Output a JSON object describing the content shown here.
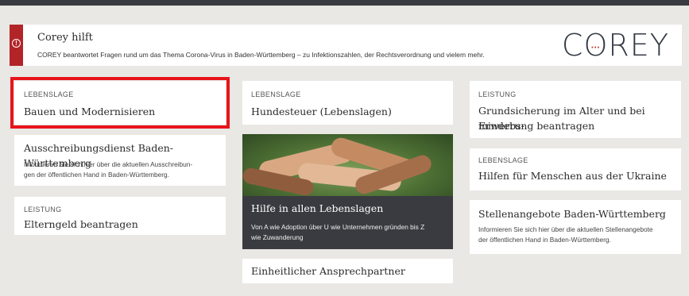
{
  "corey": {
    "icon": "info-icon",
    "title": "Corey hilft",
    "description": "COREY beantwortet Fragen rund um das Thema Corona-Virus in Baden-Württemberg – zu Infektionszahlen, der Rechtsverordnung und vielem mehr.",
    "logo_c": "C",
    "logo_o": "O",
    "logo_rest": "REY",
    "logo_dots": "···",
    "accent": "#b32428"
  },
  "cards": {
    "bauen": {
      "kicker": "LEBENSLAGE",
      "title": "Bauen und Modernisieren"
    },
    "hundesteuer": {
      "kicker": "LEBENSLAGE",
      "title": "Hundesteuer (Lebenslagen)"
    },
    "grundsicherung": {
      "kicker": "LEISTUNG",
      "title_1": "Grundsicherung im Alter und bei Erwerbs-",
      "title_2": "minderung beantragen"
    },
    "ausschreibung": {
      "title": "Ausschreibungsdienst Baden-Württemberg",
      "desc_1": "Informieren Sie sich hier über die aktuellen Ausschreibun-",
      "desc_2": "gen der öffentlichen Hand in Baden-Württemberg."
    },
    "ukraine": {
      "kicker": "LEBENSLAGE",
      "title": "Hilfen für Menschen aus der Ukraine"
    },
    "elterngeld": {
      "kicker": "LEISTUNG",
      "title": "Elterngeld beantragen"
    },
    "hilfe": {
      "title": "Hilfe in allen Lebenslagen",
      "desc_1": "Von A wie Adoption über U wie Unternehmen gründen bis Z",
      "desc_2": "wie Zuwanderung"
    },
    "stellen": {
      "title": "Stellenangebote Baden-Württemberg",
      "desc_1": "Informieren Sie sich hier über die aktuellen Stellenangebote",
      "desc_2": "der öffentlichen Hand in Baden-Württemberg."
    },
    "ansprech": {
      "title": "Einheitlicher Ansprechpartner"
    }
  },
  "highlight_color": "#e8141b"
}
